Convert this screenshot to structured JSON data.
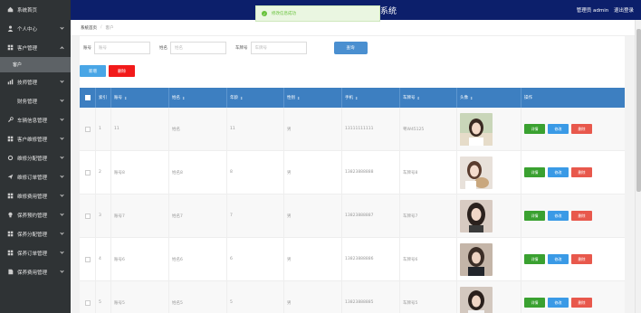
{
  "header": {
    "system_title": "系统",
    "user_label": "管理员 admin",
    "logout_label": "退出登录"
  },
  "toast": {
    "message": "修改信息成功"
  },
  "sidebar": {
    "items": [
      {
        "label": "系统首页",
        "icon": "home-icon"
      },
      {
        "label": "个人中心",
        "icon": "user-icon"
      },
      {
        "label": "客户管理",
        "icon": "grid-icon",
        "expanded": true,
        "sub": "客户"
      },
      {
        "label": "技师管理",
        "icon": "chart-icon"
      },
      {
        "label": "财务管理",
        "icon": "dot-icon"
      },
      {
        "label": "车辆信息管理",
        "icon": "wrench-icon"
      },
      {
        "label": "客户维修管理",
        "icon": "grid-icon"
      },
      {
        "label": "维修分配管理",
        "icon": "gear-icon"
      },
      {
        "label": "维修订单管理",
        "icon": "send-icon"
      },
      {
        "label": "维修费用管理",
        "icon": "grid-icon"
      },
      {
        "label": "保养预约管理",
        "icon": "bulb-icon"
      },
      {
        "label": "保养分配管理",
        "icon": "grid-icon"
      },
      {
        "label": "保养订单管理",
        "icon": "grid-icon"
      },
      {
        "label": "保养费用管理",
        "icon": "file-icon"
      }
    ]
  },
  "breadcrumb": {
    "home": "系统首页",
    "current": "客户"
  },
  "search": {
    "fields": [
      {
        "label": "账号",
        "placeholder": "账号"
      },
      {
        "label": "姓名",
        "placeholder": "姓名"
      },
      {
        "label": "车牌号",
        "placeholder": "车牌号"
      }
    ],
    "button": "查询"
  },
  "actions": {
    "add": "新增",
    "delete": "删除"
  },
  "table": {
    "headers": [
      "索引",
      "账号",
      "姓名",
      "年龄",
      "性别",
      "手机",
      "车牌号",
      "头像",
      "操作"
    ],
    "op_labels": {
      "detail": "详情",
      "edit": "修改",
      "delete": "删除"
    },
    "rows": [
      {
        "index": "1",
        "account": "11",
        "name": "姓名",
        "age": "11",
        "gender": "男",
        "phone": "13111111111",
        "plate": "粤W45125"
      },
      {
        "index": "2",
        "account": "账号8",
        "name": "姓名8",
        "age": "8",
        "gender": "男",
        "phone": "13823888888",
        "plate": "车牌号8"
      },
      {
        "index": "3",
        "account": "账号7",
        "name": "姓名7",
        "age": "7",
        "gender": "男",
        "phone": "13823888887",
        "plate": "车牌号7"
      },
      {
        "index": "4",
        "account": "账号6",
        "name": "姓名6",
        "age": "6",
        "gender": "男",
        "phone": "13823888886",
        "plate": "车牌号6"
      },
      {
        "index": "5",
        "account": "账号5",
        "name": "姓名5",
        "age": "5",
        "gender": "男",
        "phone": "13823888885",
        "plate": "车牌号5"
      }
    ]
  },
  "colors": {
    "sidebar_bg": "#2f3335",
    "header_bg": "#0c1f6b",
    "table_header": "#3d7fc1",
    "search_button": "#4a8fd0",
    "add_button": "#49a6e6",
    "delete_button": "#f21a1a",
    "detail_op": "#3aa130",
    "edit_op": "#3a9ae6",
    "delete_op": "#e8584c"
  }
}
